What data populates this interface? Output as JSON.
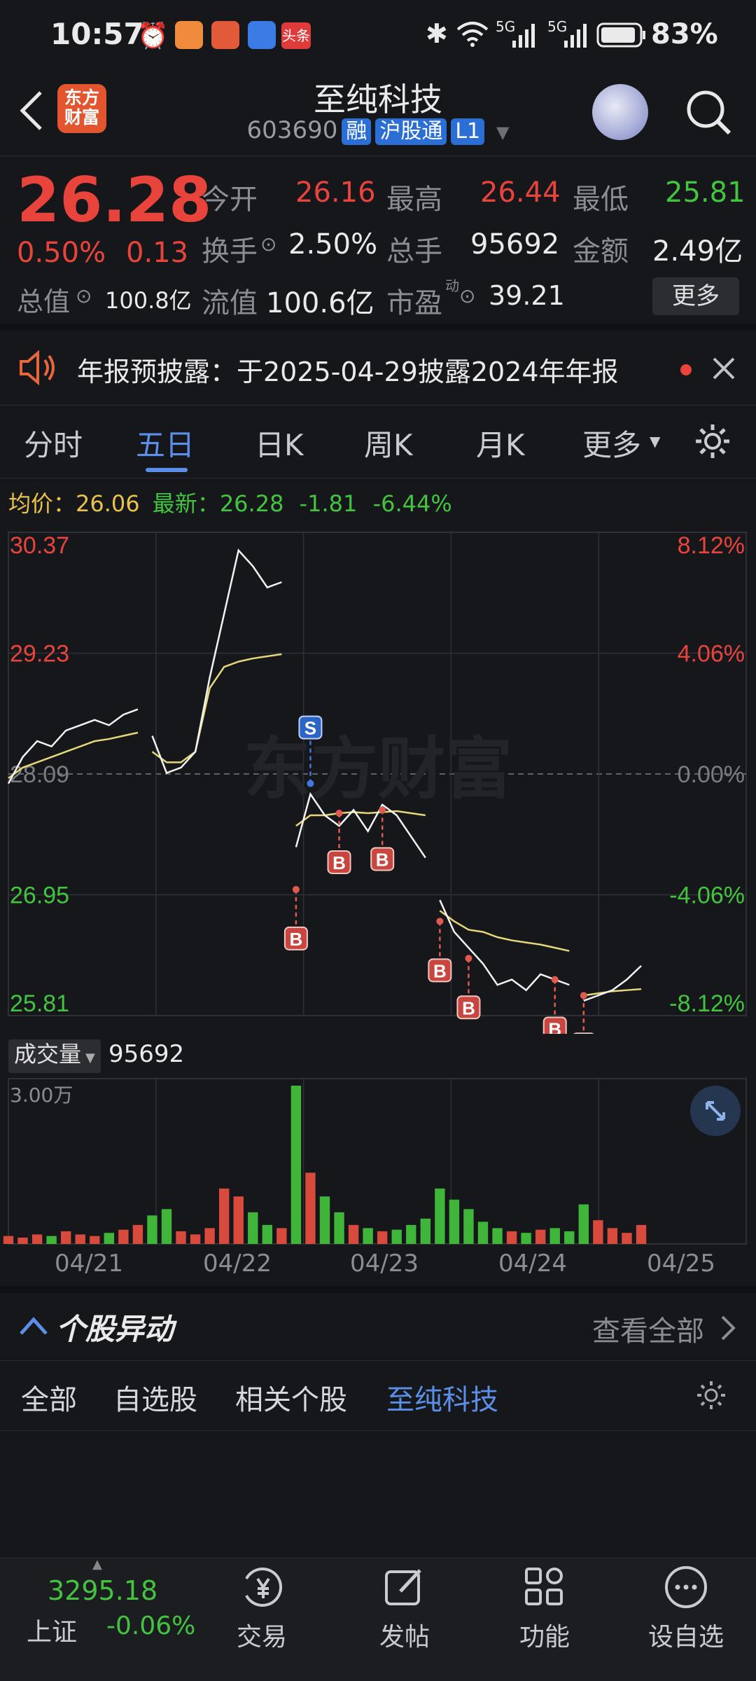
{
  "status_bar": {
    "time": "10:57",
    "battery": "83%",
    "app_badge": "头条"
  },
  "header": {
    "logo_text": "东方财富",
    "title": "至纯科技",
    "code": "603690",
    "tags": [
      "融",
      "沪股通",
      "L1"
    ]
  },
  "quote": {
    "price": "26.28",
    "change_pct": "0.50%",
    "change_amt": "0.13",
    "open_label": "今开",
    "open": "26.16",
    "high_label": "最高",
    "high": "26.44",
    "low_label": "最低",
    "low": "25.81",
    "turnover_label": "换手",
    "turnover": "2.50%",
    "volume_label": "总手",
    "volume": "95692",
    "amount_label": "金额",
    "amount": "2.49亿",
    "mcap_label": "总值",
    "mcap": "100.8亿",
    "float_label": "流值",
    "float": "100.6亿",
    "pe_label": "市盈",
    "pe_sup": "动",
    "pe": "39.21",
    "more_button": "更多"
  },
  "notice": {
    "text": "年报预披露：于2025-04-29披露2024年年报"
  },
  "tabs": [
    {
      "label": "分时"
    },
    {
      "label": "五日"
    },
    {
      "label": "日K"
    },
    {
      "label": "周K"
    },
    {
      "label": "月K"
    },
    {
      "label": "更多"
    }
  ],
  "active_tab": "五日",
  "chart_info": {
    "avg_label": "均价：",
    "avg": "26.06",
    "last_label": "最新：",
    "last": "26.28",
    "diff": "-1.81",
    "diff_pct": "-6.44%"
  },
  "chart_data": {
    "type": "line",
    "y_ticks_left": [
      "30.37",
      "29.23",
      "28.09",
      "26.95",
      "25.81"
    ],
    "y_ticks_right": [
      "8.12%",
      "4.06%",
      "0.00%",
      "-4.06%",
      "-8.12%"
    ],
    "ylim": [
      25.81,
      30.37
    ],
    "x_days": [
      "04/21",
      "04/22",
      "04/23",
      "04/24",
      "04/25"
    ],
    "price": [
      28.0,
      28.25,
      28.4,
      28.35,
      28.5,
      28.55,
      28.6,
      28.55,
      28.65,
      28.7,
      28.45,
      28.1,
      28.15,
      28.3,
      29.0,
      29.6,
      30.2,
      30.05,
      29.85,
      29.9,
      27.4,
      27.9,
      27.7,
      27.6,
      27.75,
      27.55,
      27.8,
      27.7,
      27.5,
      27.3,
      26.9,
      26.6,
      26.45,
      26.3,
      26.1,
      26.15,
      26.05,
      26.2,
      26.15,
      26.1,
      25.95,
      26.0,
      26.05,
      26.15,
      26.28
    ],
    "avg_price": [
      28.05,
      28.15,
      28.2,
      28.25,
      28.3,
      28.35,
      28.4,
      28.42,
      28.45,
      28.48,
      28.3,
      28.2,
      28.2,
      28.3,
      28.9,
      29.1,
      29.15,
      29.18,
      29.2,
      29.22,
      27.6,
      27.7,
      27.7,
      27.72,
      27.73,
      27.72,
      27.73,
      27.74,
      27.72,
      27.7,
      26.8,
      26.7,
      26.62,
      26.6,
      26.55,
      26.52,
      26.5,
      26.48,
      26.45,
      26.42,
      26.0,
      26.02,
      26.04,
      26.05,
      26.06
    ],
    "markers": [
      {
        "type": "B",
        "index": 20,
        "price": 27.0
      },
      {
        "type": "S",
        "index": 21,
        "price": 28.0
      },
      {
        "type": "B",
        "index": 23,
        "price": 27.72
      },
      {
        "type": "B",
        "index": 26,
        "price": 27.75
      },
      {
        "type": "B",
        "index": 30,
        "price": 26.7
      },
      {
        "type": "B",
        "index": 32,
        "price": 26.35
      },
      {
        "type": "B",
        "index": 38,
        "price": 26.15
      },
      {
        "type": "B",
        "index": 40,
        "price": 26.0
      }
    ]
  },
  "volume": {
    "label": "成交量",
    "value": "95692",
    "scale": "3.00万",
    "bars": [
      0.05,
      0.04,
      0.06,
      0.05,
      0.08,
      0.06,
      0.05,
      0.07,
      0.09,
      0.12,
      0.18,
      0.22,
      0.08,
      0.06,
      0.1,
      0.35,
      0.3,
      0.2,
      0.12,
      0.1,
      1.0,
      0.45,
      0.3,
      0.2,
      0.12,
      0.1,
      0.08,
      0.09,
      0.12,
      0.16,
      0.35,
      0.28,
      0.22,
      0.14,
      0.1,
      0.08,
      0.07,
      0.09,
      0.1,
      0.08,
      0.25,
      0.15,
      0.1,
      0.07,
      0.12
    ]
  },
  "anomaly": {
    "title": "个股异动",
    "view_all": "查看全部"
  },
  "filters": [
    "全部",
    "自选股",
    "相关个股",
    "至纯科技"
  ],
  "bottom_nav": {
    "index_value": "3295.18",
    "index_name": "上证",
    "index_change": "-0.06%",
    "items": [
      {
        "label": "交易",
        "icon": "yen-icon"
      },
      {
        "label": "发帖",
        "icon": "edit-icon"
      },
      {
        "label": "功能",
        "icon": "grid-icon"
      },
      {
        "label": "设自选",
        "icon": "more-icon"
      }
    ]
  },
  "colors": {
    "up": "#e8443c",
    "down": "#43c43f",
    "avg_line": "#e6d77a",
    "accent": "#5b8fe8"
  }
}
